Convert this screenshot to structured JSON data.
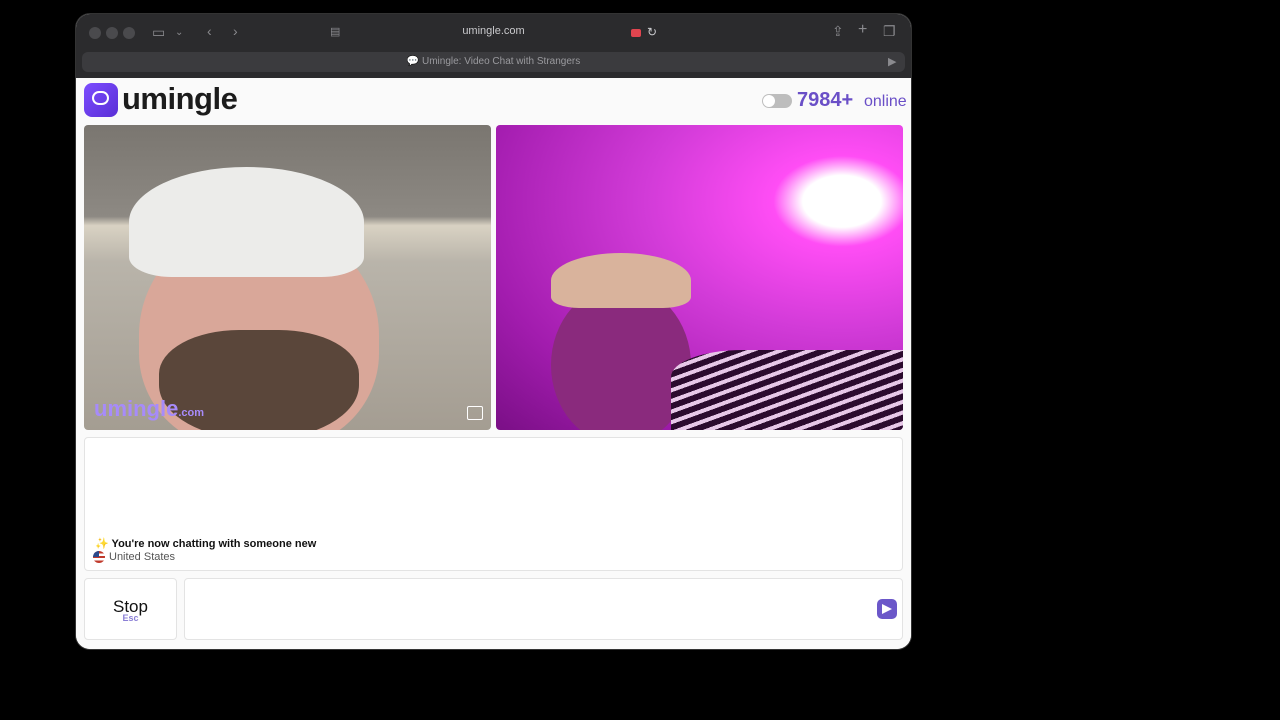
{
  "browser": {
    "url": "umingle.com",
    "tab_title": "Umingle: Video Chat with Strangers"
  },
  "header": {
    "logo_text": "umingle",
    "online_count": "7984+",
    "online_label": "online"
  },
  "video": {
    "watermark_main": "umingle",
    "watermark_suffix": ".com"
  },
  "chat": {
    "system_message": "✨ You're now chatting with someone new",
    "country": "United States"
  },
  "controls": {
    "stop_label": "Stop",
    "stop_shortcut": "Esc"
  },
  "colors": {
    "accent": "#6a4fc7",
    "watermark": "#a78bfa"
  }
}
